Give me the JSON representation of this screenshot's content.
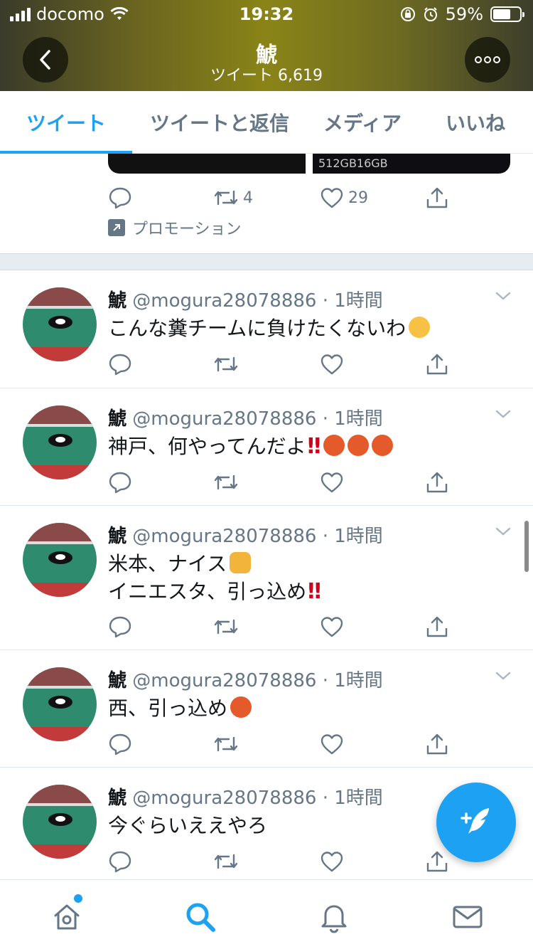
{
  "status_bar": {
    "carrier": "docomo",
    "time": "19:32",
    "battery_text": "59%"
  },
  "profile_header": {
    "title": "鯱",
    "subtitle": "ツイート 6,619",
    "back_icon": "chevron-left-icon",
    "more_icon": "more-dots-icon"
  },
  "tabs": [
    {
      "label": "ツイート",
      "active": true
    },
    {
      "label": "ツイートと返信",
      "active": false
    },
    {
      "label": "メディア",
      "active": false
    },
    {
      "label": "いいね",
      "active": false
    }
  ],
  "promo": {
    "card_left_text": "",
    "card_right_text": "512GB16GB",
    "retweet_count": "4",
    "like_count": "29",
    "label": "プロモーション"
  },
  "tweets": [
    {
      "name": "鯱",
      "handle": "@mogura28078886",
      "time": "· 1時間",
      "lines": [
        "こんな糞チームに負けたくないわ"
      ],
      "emoji": [
        "thinking-face"
      ]
    },
    {
      "name": "鯱",
      "handle": "@mogura28078886",
      "time": "· 1時間",
      "lines": [
        "神戸、何やってんだよ"
      ],
      "emoji": [
        "double-exclamation",
        "angry-face",
        "angry-face",
        "angry-face"
      ]
    },
    {
      "name": "鯱",
      "handle": "@mogura28078886",
      "time": "· 1時間",
      "lines": [
        "米本、ナイス",
        "イニエスタ、引っ込め"
      ],
      "emoji": [
        "thumbs-up",
        "double-exclamation"
      ]
    },
    {
      "name": "鯱",
      "handle": "@mogura28078886",
      "time": "· 1時間",
      "lines": [
        "西、引っ込め"
      ],
      "emoji": [
        "angry-face"
      ]
    },
    {
      "name": "鯱",
      "handle": "@mogura28078886",
      "time": "· 1時間",
      "lines": [
        "今ぐらいええやろ"
      ],
      "emoji": []
    }
  ],
  "tabbar": [
    {
      "name": "home-icon",
      "active": false,
      "has_badge": true
    },
    {
      "name": "search-icon",
      "active": true
    },
    {
      "name": "notifications-bell-icon",
      "active": false
    },
    {
      "name": "messages-envelope-icon",
      "active": false
    }
  ],
  "fab": {
    "icon": "compose-tweet-icon"
  },
  "colors": {
    "accent": "#1da1f2",
    "text_primary": "#14171a",
    "text_secondary": "#657786",
    "divider": "#e1e8ed"
  }
}
